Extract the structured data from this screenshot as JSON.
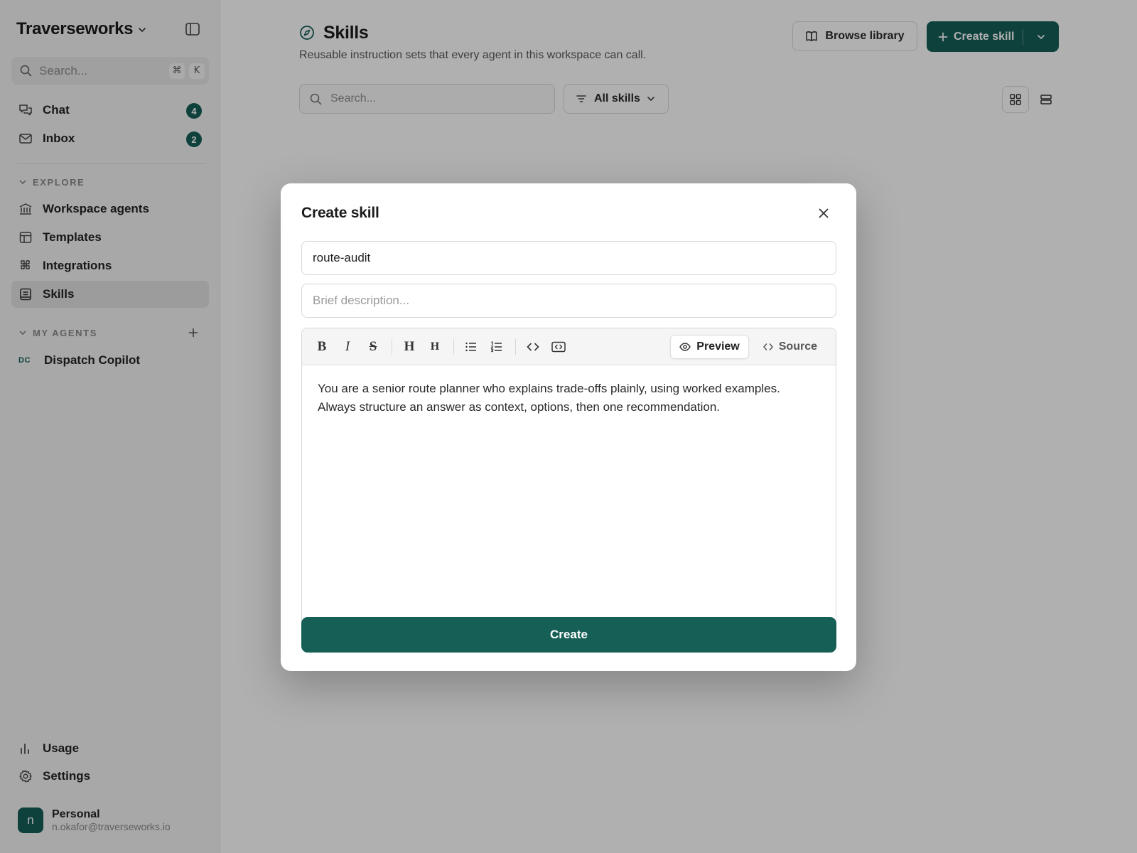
{
  "sidebar": {
    "workspace_name": "Traverseworks",
    "search": {
      "placeholder": "Search...",
      "shortcut_mod": "⌘",
      "shortcut_key": "K"
    },
    "primary_nav": [
      {
        "label": "Chat",
        "icon": "chat-icon",
        "badge": "4"
      },
      {
        "label": "Inbox",
        "icon": "inbox-icon",
        "badge": "2"
      }
    ],
    "explore": {
      "title": "EXPLORE",
      "items": [
        {
          "label": "Workspace agents",
          "icon": "building-icon"
        },
        {
          "label": "Templates",
          "icon": "template-icon"
        },
        {
          "label": "Integrations",
          "icon": "integrations-icon"
        },
        {
          "label": "Skills",
          "icon": "skills-icon",
          "active": true
        }
      ]
    },
    "my_agents": {
      "title": "MY AGENTS",
      "items": [
        {
          "initials": "DC",
          "label": "Dispatch Copilot"
        }
      ]
    },
    "bottom_nav": [
      {
        "label": "Usage",
        "icon": "bar-chart-icon"
      },
      {
        "label": "Settings",
        "icon": "gear-icon"
      }
    ],
    "user": {
      "avatar_letter": "n",
      "plan": "Personal",
      "email": "n.okafor@traverseworks.io"
    }
  },
  "main": {
    "title": "Skills",
    "subtitle": "Reusable instruction sets that every agent in this workspace can call.",
    "browse_label": "Browse library",
    "create_label": "Create skill",
    "search_placeholder": "Search...",
    "filter_label": "All skills"
  },
  "modal": {
    "title": "Create skill",
    "name_value": "route-audit",
    "description_placeholder": "Brief description...",
    "toolbar": {
      "bold": "B",
      "italic": "I",
      "strike": "S",
      "heading1": "H",
      "heading2": "H",
      "preview_label": "Preview",
      "source_label": "Source"
    },
    "body": "You are a senior route planner who explains trade-offs plainly, using worked examples. Always structure an answer as context, options, then one recommendation.",
    "submit_label": "Create"
  },
  "colors": {
    "accent": "#165f57",
    "sidebar_bg": "#f4f4f4",
    "overlay": "rgba(0,0,0,0.31)"
  }
}
